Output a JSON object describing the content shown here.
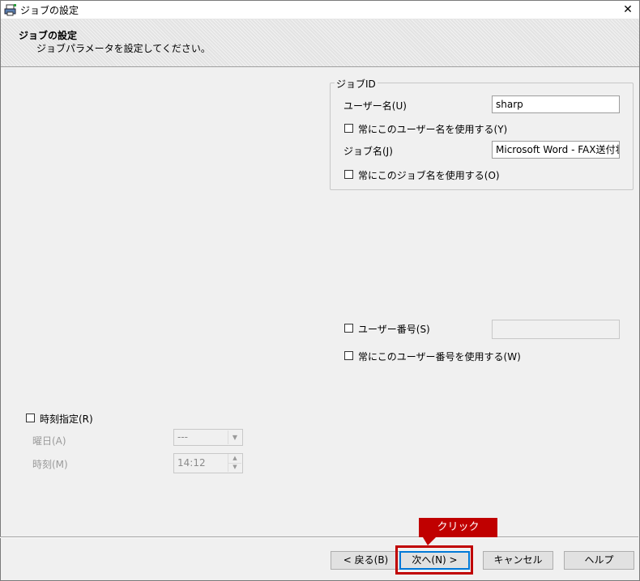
{
  "window": {
    "title": "ジョブの設定",
    "close_glyph": "✕",
    "icon": "printer-app-icon"
  },
  "header": {
    "title": "ジョブの設定",
    "subtitle": "ジョブパラメータを設定してください。"
  },
  "job_id_group": {
    "label": "ジョブID",
    "user_name_label": "ユーザー名(U)",
    "user_name_value": "sharp",
    "always_user_name_label": "常にこのユーザー名を使用する(Y)",
    "job_name_label": "ジョブ名(J)",
    "job_name_value": "Microsoft Word - FAX送付状",
    "always_job_name_label": "常にこのジョブ名を使用する(O)"
  },
  "user_number": {
    "label": "ユーザー番号(S)",
    "value": "",
    "always_label": "常にこのユーザー番号を使用する(W)"
  },
  "schedule": {
    "label": "時刻指定(R)",
    "day_label": "曜日(A)",
    "day_value": "---",
    "time_label": "時刻(M)",
    "time_value": "14:12"
  },
  "buttons": {
    "back": "< 戻る(B)",
    "next": "次へ(N) >",
    "cancel": "キャンセル",
    "help": "ヘルプ"
  },
  "annotation": {
    "callout": "クリック",
    "color": "#c00000"
  }
}
